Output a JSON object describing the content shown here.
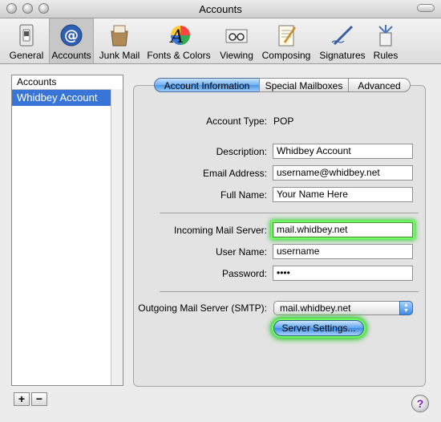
{
  "window": {
    "title": "Accounts"
  },
  "toolbar": {
    "items": [
      {
        "label": "General",
        "icon": "light-switch-icon"
      },
      {
        "label": "Accounts",
        "icon": "at-sign-icon"
      },
      {
        "label": "Junk Mail",
        "icon": "junk-mail-icon"
      },
      {
        "label": "Fonts & Colors",
        "icon": "fonts-colors-icon"
      },
      {
        "label": "Viewing",
        "icon": "viewing-glasses-icon"
      },
      {
        "label": "Composing",
        "icon": "composing-icon"
      },
      {
        "label": "Signatures",
        "icon": "signature-pen-icon"
      },
      {
        "label": "Rules",
        "icon": "rules-icon"
      }
    ],
    "selected": "Accounts"
  },
  "accounts": {
    "header": "Accounts",
    "items": [
      "Whidbey Account"
    ],
    "add_label": "+",
    "remove_label": "−"
  },
  "tabs": [
    "Account Information",
    "Special Mailboxes",
    "Advanced"
  ],
  "form": {
    "account_type_label": "Account Type:",
    "account_type_value": "POP",
    "description_label": "Description:",
    "description_value": "Whidbey Account",
    "email_label": "Email Address:",
    "email_value": "username@whidbey.net",
    "fullname_label": "Full Name:",
    "fullname_value": "Your Name Here",
    "incoming_label": "Incoming Mail Server:",
    "incoming_value": "mail.whidbey.net",
    "username_label": "User Name:",
    "username_value": "username",
    "password_label": "Password:",
    "password_value": "••••",
    "outgoing_label": "Outgoing Mail Server (SMTP):",
    "outgoing_value": "mail.whidbey.net",
    "server_settings_label": "Server Settings..."
  },
  "help_label": "?",
  "colors": {
    "highlight_glow": "#1fd01f",
    "selection": "#3875d7",
    "aqua_blue": "#4c98e6"
  }
}
